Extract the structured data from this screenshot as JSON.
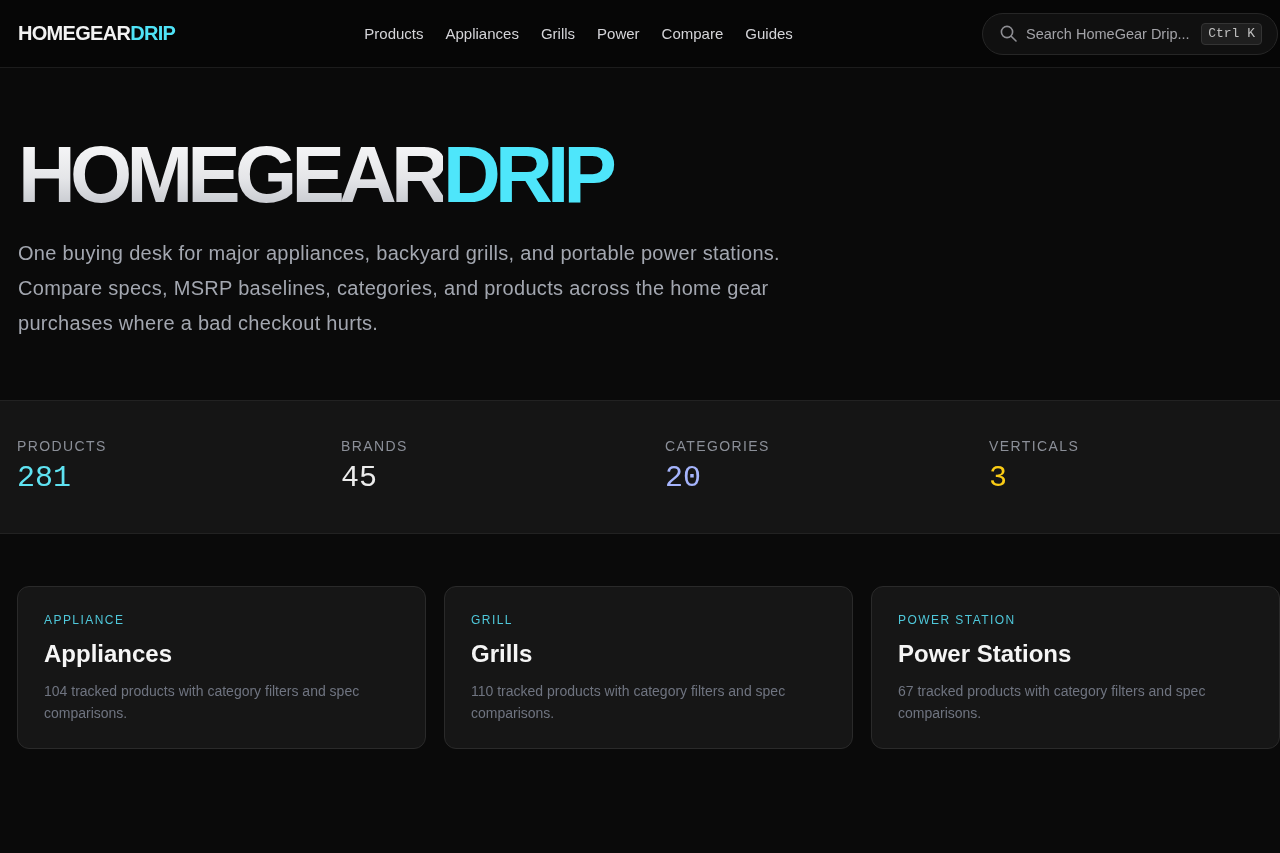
{
  "header": {
    "logo": {
      "main": "HOMEGEAR",
      "accent": "DRIP"
    },
    "nav": [
      "Products",
      "Appliances",
      "Grills",
      "Power",
      "Compare",
      "Guides"
    ],
    "search": {
      "placeholder": "Search HomeGear Drip...",
      "shortcut": "Ctrl K"
    }
  },
  "hero": {
    "title": {
      "main": "HOMEGEAR",
      "accent": "DRIP"
    },
    "description": "One buying desk for major appliances, backyard grills, and portable power stations. Compare specs, MSRP baselines, categories, and products across the home gear purchases where a bad checkout hurts."
  },
  "stats": [
    {
      "label": "PRODUCTS",
      "value": "281",
      "color": "#5fe3f2"
    },
    {
      "label": "BRANDS",
      "value": "45",
      "color": "#ececec"
    },
    {
      "label": "CATEGORIES",
      "value": "20",
      "color": "#a5b4fc"
    },
    {
      "label": "VERTICALS",
      "value": "3",
      "color": "#facc15"
    }
  ],
  "cards": [
    {
      "tag": "APPLIANCE",
      "title": "Appliances",
      "description": "104 tracked products with category filters and spec comparisons."
    },
    {
      "tag": "GRILL",
      "title": "Grills",
      "description": "110 tracked products with category filters and spec comparisons."
    },
    {
      "tag": "POWER STATION",
      "title": "Power Stations",
      "description": "67 tracked products with category filters and spec comparisons."
    }
  ]
}
